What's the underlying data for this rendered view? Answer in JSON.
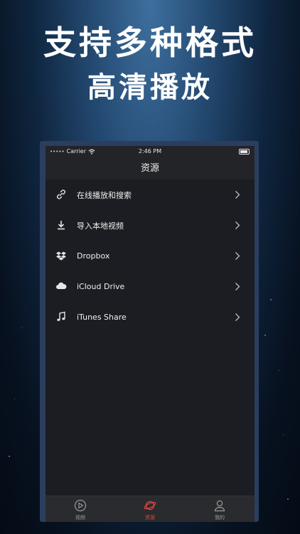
{
  "headline": {
    "line1": "支持多种格式",
    "line2": "高清播放"
  },
  "status_bar": {
    "carrier": "Carrier",
    "time": "2:46 PM"
  },
  "nav": {
    "title": "资源"
  },
  "list": [
    {
      "label": "在线播放和搜索",
      "icon": "link-icon"
    },
    {
      "label": "导入本地视频",
      "icon": "download-icon"
    },
    {
      "label": "Dropbox",
      "icon": "dropbox-icon"
    },
    {
      "label": "iCloud Drive",
      "icon": "cloud-icon"
    },
    {
      "label": "iTunes Share",
      "icon": "music-note-icon"
    }
  ],
  "tabs": [
    {
      "label": "视频",
      "icon": "play-circle-icon",
      "active": false
    },
    {
      "label": "资源",
      "icon": "planet-icon",
      "active": true
    },
    {
      "label": "我的",
      "icon": "person-icon",
      "active": false
    }
  ],
  "colors": {
    "accent": "#e0483e",
    "screen_bg": "#1c1d22",
    "bar_bg": "#232428"
  }
}
